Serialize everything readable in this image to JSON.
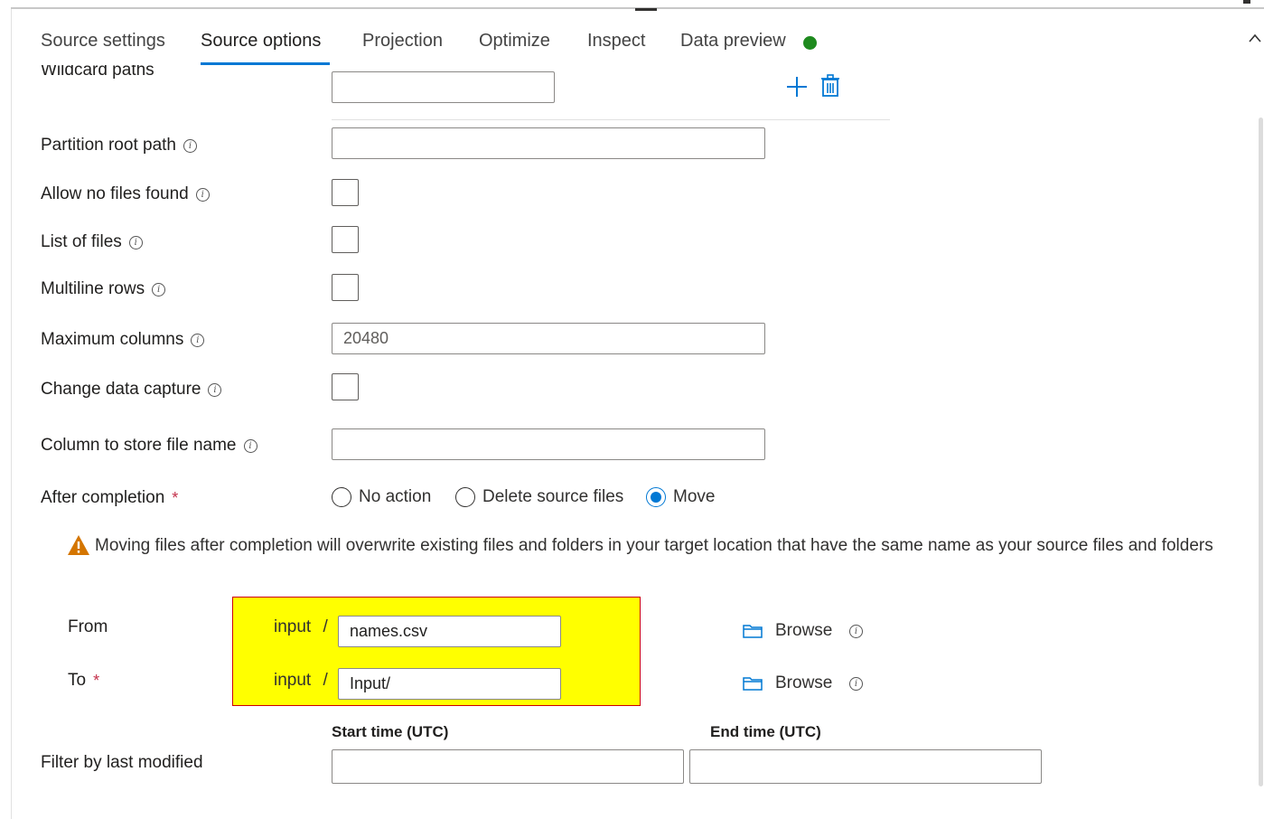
{
  "tabs": [
    {
      "label": "Source settings"
    },
    {
      "label": "Source options"
    },
    {
      "label": "Projection"
    },
    {
      "label": "Optimize"
    },
    {
      "label": "Inspect"
    },
    {
      "label": "Data preview"
    }
  ],
  "active_tab": "Source options",
  "status_dot_color": "#1e8a1e",
  "accent_color": "#0078d4",
  "form": {
    "wildcard_paths": {
      "label": "Wildcard paths",
      "value": ""
    },
    "partition_root_path": {
      "label": "Partition root path",
      "value": ""
    },
    "allow_no_files": {
      "label": "Allow no files found",
      "checked": false
    },
    "list_of_files": {
      "label": "List of files",
      "checked": false
    },
    "multiline_rows": {
      "label": "Multiline rows",
      "checked": false
    },
    "maximum_columns": {
      "label": "Maximum columns",
      "value": "20480"
    },
    "change_data_capture": {
      "label": "Change data capture",
      "checked": false
    },
    "column_file_name": {
      "label": "Column to store file name",
      "value": ""
    },
    "after_completion": {
      "label": "After completion",
      "required_mark": "*",
      "options": [
        "No action",
        "Delete source files",
        "Move"
      ],
      "selected": "Move"
    },
    "warning": "Moving files after completion will overwrite existing files and folders in your target location that have the same name as your source files and folders",
    "from": {
      "label": "From",
      "prefix": "input",
      "separator": "/",
      "value": "names.csv",
      "browse": "Browse"
    },
    "to": {
      "label": "To",
      "required_mark": "*",
      "prefix": "input",
      "separator": "/",
      "value": "Input/",
      "browse": "Browse"
    },
    "filter": {
      "label": "Filter by last modified",
      "start_label": "Start time (UTC)",
      "end_label": "End time (UTC)",
      "start_value": "",
      "end_value": ""
    }
  },
  "icons": {
    "add": "plus-icon",
    "delete": "trash-icon",
    "info": "info-icon",
    "warning": "warning-icon",
    "folder": "folder-icon",
    "collapse": "chevron-up-icon"
  },
  "highlight_color": "#ffff00"
}
